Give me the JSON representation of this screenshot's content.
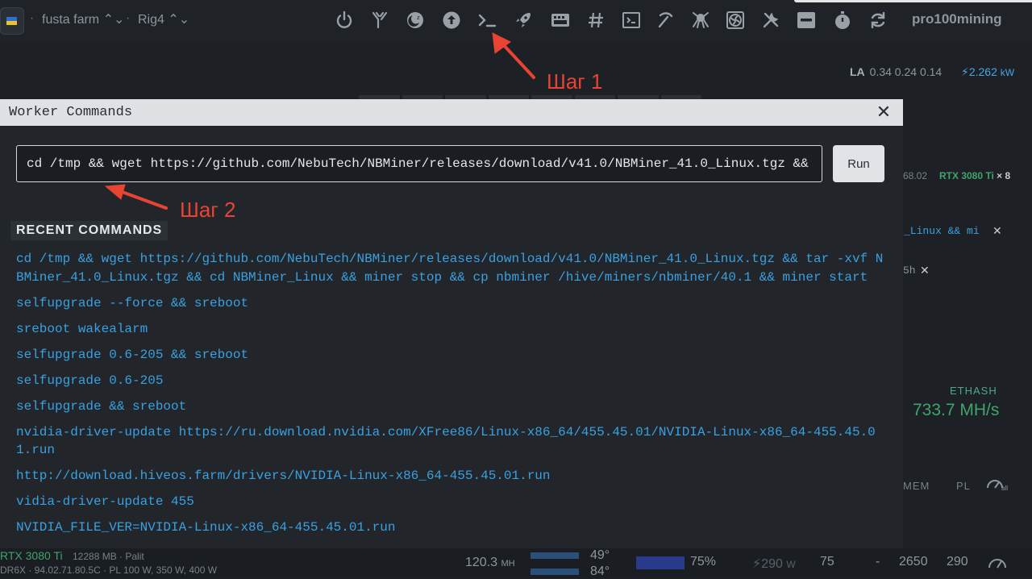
{
  "topbar": {
    "farm_name": "fusta farm ⌃⌄",
    "rig_name": "Rig4 ⌃⌄",
    "separator": "·",
    "brand": "pro100mining",
    "icons": [
      "power-icon",
      "tools-fork-icon",
      "moon-icon",
      "upload-icon",
      "terminal-icon",
      "rocket-icon",
      "keyboard-icon",
      "hash-icon",
      "console-box-icon",
      "pickaxe-icon",
      "octopus-icon",
      "fan-icon",
      "wrench-icon",
      "minus-box-icon",
      "stopwatch-icon",
      "refresh-icon"
    ]
  },
  "dashboard": {
    "la_label": "LA",
    "la_values": "0.34 0.24 0.14",
    "power": "2.262",
    "power_unit": "kW",
    "version": "68.02",
    "gpu_model": "RTX 3080 Ti",
    "gpu_count": "× 8",
    "bg_command_1": "_Linux && mi",
    "bg_command_2": "5h",
    "algo": "ETHASH",
    "hashrate": "733.7 MH/s",
    "columns": {
      "mem": "MEM",
      "pl": "PL",
      "all": "all"
    },
    "gpu_row": {
      "name": "RTX 3080 Ti",
      "memory": "12288 MB · Palit",
      "details": "DR6X · 94.02.71.80.5C · PL 100 W, 350 W, 400 W",
      "hashrate": "120.3",
      "hash_unit": "MH",
      "temp_core": "49°",
      "temp_mem": "84°",
      "fan": "75%",
      "power": "290",
      "power_unit": "W",
      "pl": "75",
      "dash": "-",
      "core_clock": "2650",
      "mem_clock": "290"
    }
  },
  "modal": {
    "title": "Worker Commands",
    "close_glyph": "✕",
    "input_value": "cd /tmp && wget https://github.com/NebuTech/NBMiner/releases/download/v41.0/NBMiner_41.0_Linux.tgz && tar -xvf NBMiner_41.0_Linux.tgz && cd NBMiner_Linux && miner stop && cp nbminer /hive/miners/nbminer/40.1 && miner start",
    "run_label": "Run",
    "recent_heading": "RECENT COMMANDS",
    "recent_commands": [
      "cd /tmp && wget https://github.com/NebuTech/NBMiner/releases/download/v41.0/NBMiner_41.0_Linux.tgz && tar -xvf NBMiner_41.0_Linux.tgz && cd NBMiner_Linux && miner stop && cp nbminer /hive/miners/nbminer/40.1 && miner start",
      "selfupgrade --force && sreboot",
      "sreboot wakealarm",
      "selfupgrade 0.6-205 && sreboot",
      "selfupgrade 0.6-205",
      "selfupgrade && sreboot",
      "nvidia-driver-update https://ru.download.nvidia.com/XFree86/Linux-x86_64/455.45.01/NVIDIA-Linux-x86_64-455.45.01.run",
      "http://download.hiveos.farm/drivers/NVIDIA-Linux-x86_64-455.45.01.run",
      "vidia-driver-update 455",
      "NVIDIA_FILE_VER=NVIDIA-Linux-x86_64-455.45.01.run"
    ]
  },
  "annotations": {
    "step1": "Шаг 1",
    "step2": "Шаг 2",
    "color": "#e84333"
  }
}
